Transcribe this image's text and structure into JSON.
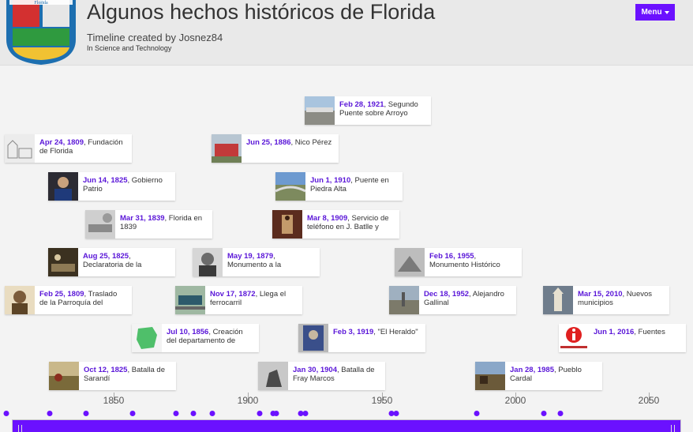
{
  "header": {
    "title": "Algunos hechos históricos de Florida",
    "byline": "Timeline created by Josnez84",
    "category": "In Science and Technology",
    "menu_label": "Menu",
    "logo_text": "Florida"
  },
  "colors": {
    "accent": "#6b11ff",
    "date": "#5a16d8"
  },
  "events": [
    {
      "date": "Feb 28, 1921",
      "text": ", Segundo Puente sobre Arroyo"
    },
    {
      "date": "Apr 24, 1809",
      "text": ", Fundación de Florida"
    },
    {
      "date": "Jun 25, 1886",
      "text": ", Nico Pérez"
    },
    {
      "date": "Jun 14, 1825",
      "text": ", Gobierno Patrio"
    },
    {
      "date": "Jun 1, 1910",
      "text": ", Puente en Piedra Alta"
    },
    {
      "date": "Mar 31, 1839",
      "text": ", Florida en 1839"
    },
    {
      "date": "Mar 8, 1909",
      "text": ", Servicio de teléfono en J. Batlle y"
    },
    {
      "date": "Aug 25, 1825",
      "text": ", Declaratoria de la"
    },
    {
      "date": "May 19, 1879",
      "text": ", Monumento a la"
    },
    {
      "date": "Feb 16, 1955",
      "text": ", Monumento Histórico"
    },
    {
      "date": "Feb 25, 1809",
      "text": ", Traslado de la Parroquía del"
    },
    {
      "date": "Nov 17, 1872",
      "text": ", Llega el ferrocarril"
    },
    {
      "date": "Dec 18, 1952",
      "text": ", Alejandro Gallinal"
    },
    {
      "date": "Mar 15, 2010",
      "text": ", Nuevos municipios"
    },
    {
      "date": "Jul 10, 1856",
      "text": ", Creación del departamento de"
    },
    {
      "date": "Feb 3, 1919",
      "text": ", \"El Heraldo\""
    },
    {
      "date": "Jun 1, 2016",
      "text": ", Fuentes"
    },
    {
      "date": "Oct 12, 1825",
      "text": ", Batalla de Sarandí"
    },
    {
      "date": "Jan 30, 1904",
      "text": ", Batalla de Fray Marcos"
    },
    {
      "date": "Jan 28, 1985",
      "text": ", Pueblo Cardal"
    }
  ],
  "axis": {
    "ticks": [
      "1850",
      "1900",
      "1950",
      "2000",
      "2050"
    ]
  }
}
